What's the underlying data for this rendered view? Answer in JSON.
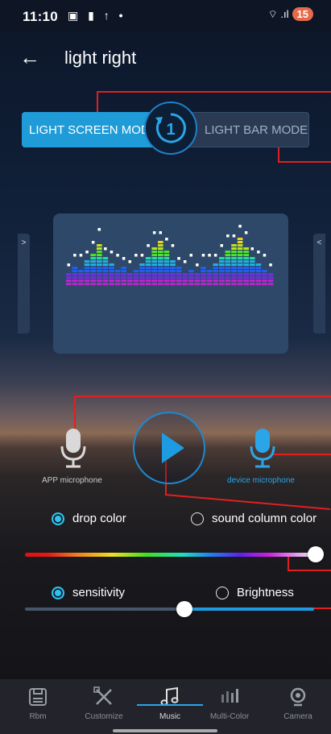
{
  "status_bar": {
    "time": "11:10",
    "icons": "▣ ▮ ↑ •",
    "signal": "⌔ .ıl",
    "battery": "15"
  },
  "header": {
    "back_icon": "back-arrow-icon",
    "title": "light right"
  },
  "mode_switch": {
    "left_label": "LIGHT SCREEN MODE",
    "right_label": "LIGHT BAR MODE",
    "dial_number": "1",
    "active": "left"
  },
  "preview": {
    "left_arrow": ">",
    "right_arrow": "<"
  },
  "microphones": {
    "app_label": "APP microphone",
    "device_label": "device microphone",
    "selected": "device"
  },
  "color_mode": {
    "drop_label": "drop color",
    "column_label": "sound column color",
    "selected": "drop"
  },
  "color_slider": {
    "value": 1.0
  },
  "adjust_mode": {
    "sensitivity_label": "sensitivity",
    "brightness_label": "Brightness",
    "selected": "sensitivity"
  },
  "level_slider": {
    "value": 0.55
  },
  "nav": {
    "items": [
      {
        "label": "Rbm",
        "icon": "save-disk-icon"
      },
      {
        "label": "Customize",
        "icon": "pencil-ruler-icon"
      },
      {
        "label": "Music",
        "icon": "music-note-icon"
      },
      {
        "label": "Multi-Color",
        "icon": "bars-icon"
      },
      {
        "label": "Camera",
        "icon": "webcam-icon"
      }
    ],
    "active": "Music"
  },
  "colors": {
    "accent": "#1f9bd8",
    "annotation": "#e02020",
    "nav_bg": "#23242b"
  }
}
